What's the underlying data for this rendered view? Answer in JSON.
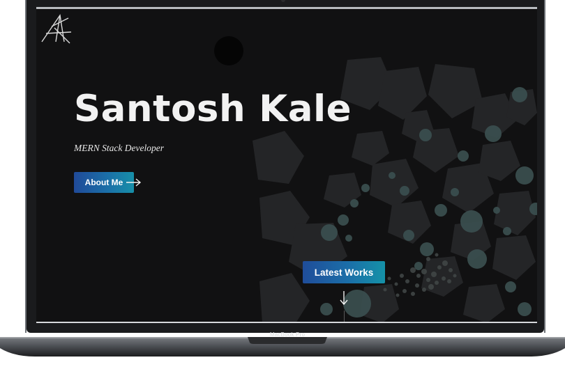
{
  "device": {
    "label": "MacBook Pro"
  },
  "site": {
    "logo": "santosh-kale-monogram-logo",
    "hero": {
      "title": "Santosh Kale",
      "subtitle": "MERN Stack Developer"
    },
    "buttons": {
      "about": "About Me",
      "latest_works": "Latest Works"
    },
    "icons": {
      "about_arrow": "arrow-right-icon",
      "scroll_arrow": "arrow-down-icon"
    }
  },
  "colors": {
    "screen_bg": "#111112",
    "button_gradient_start": "#204a98",
    "button_gradient_end": "#178fa8",
    "title_text": "#f2f2f2",
    "shape_fill": "#2a2b2d",
    "bubble_teal": "#3d5656"
  }
}
